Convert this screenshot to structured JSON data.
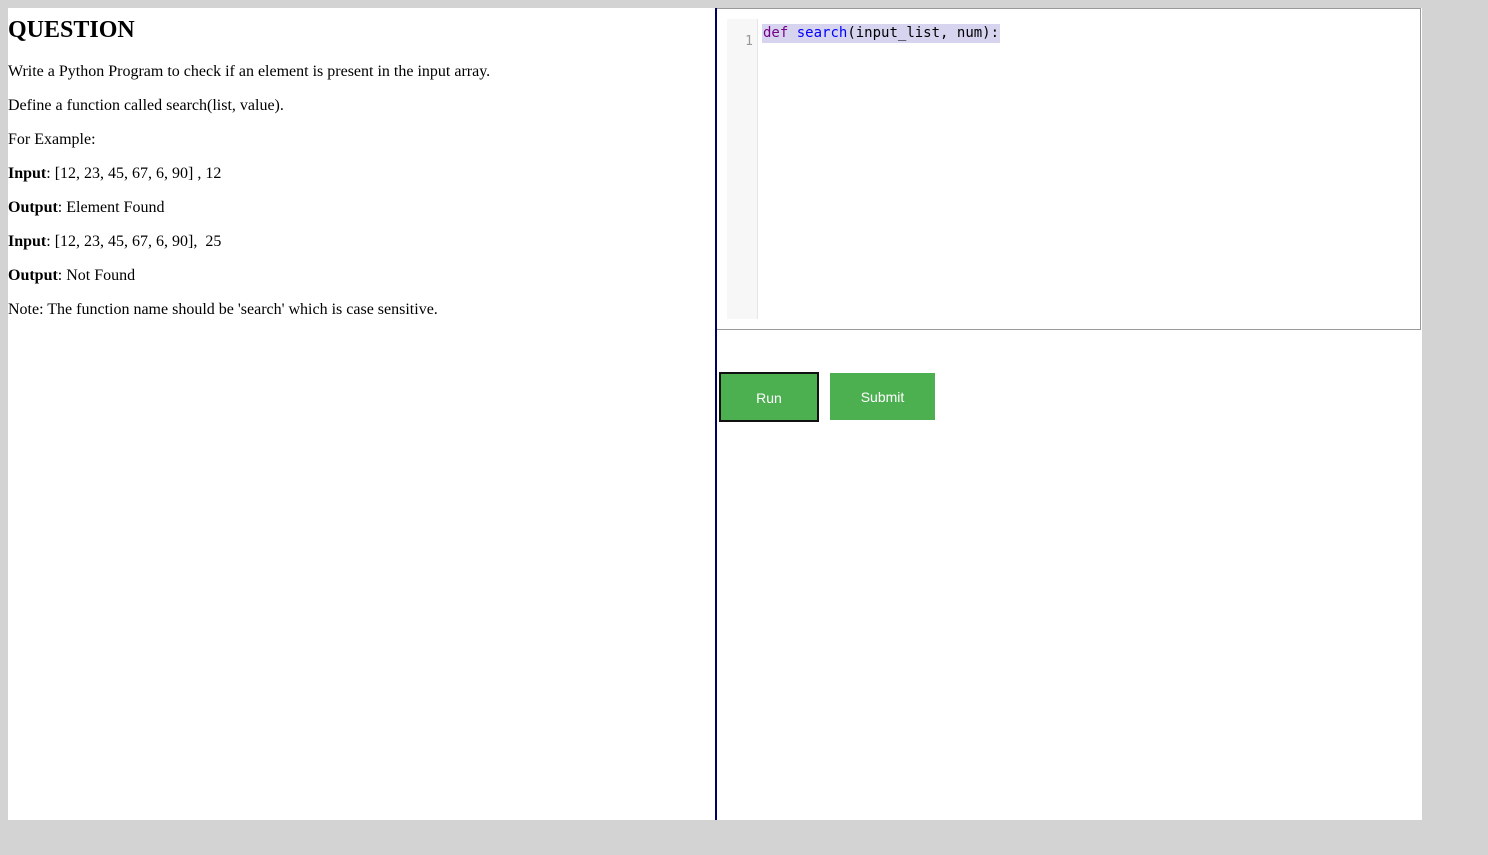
{
  "question": {
    "title": "QUESTION",
    "line1": "Write a Python Program to check if an element is present in the input array.",
    "line2": "Define a function called search(list, value).",
    "line3": "For Example:",
    "ex1_input_label": "Input",
    "ex1_input_value": ": [12, 23, 45, 67, 6, 90] , 12",
    "ex1_output_label": "Output",
    "ex1_output_value": ": Element Found",
    "ex2_input_label": "Input",
    "ex2_input_value": ": [12, 23, 45, 67, 6, 90],  25",
    "ex2_output_label": "Output",
    "ex2_output_value": ": Not Found",
    "note": "Note: The function name should be 'search' which is case sensitive."
  },
  "editor": {
    "line_number": "1",
    "code_keyword": "def",
    "code_space": " ",
    "code_function": "search",
    "code_rest": "(input_list, num):"
  },
  "buttons": {
    "run_label": "Run",
    "submit_label": "Submit"
  },
  "colors": {
    "button_green": "#4caf50",
    "divider_navy": "#000066",
    "code_highlight": "#d7d4f0"
  }
}
